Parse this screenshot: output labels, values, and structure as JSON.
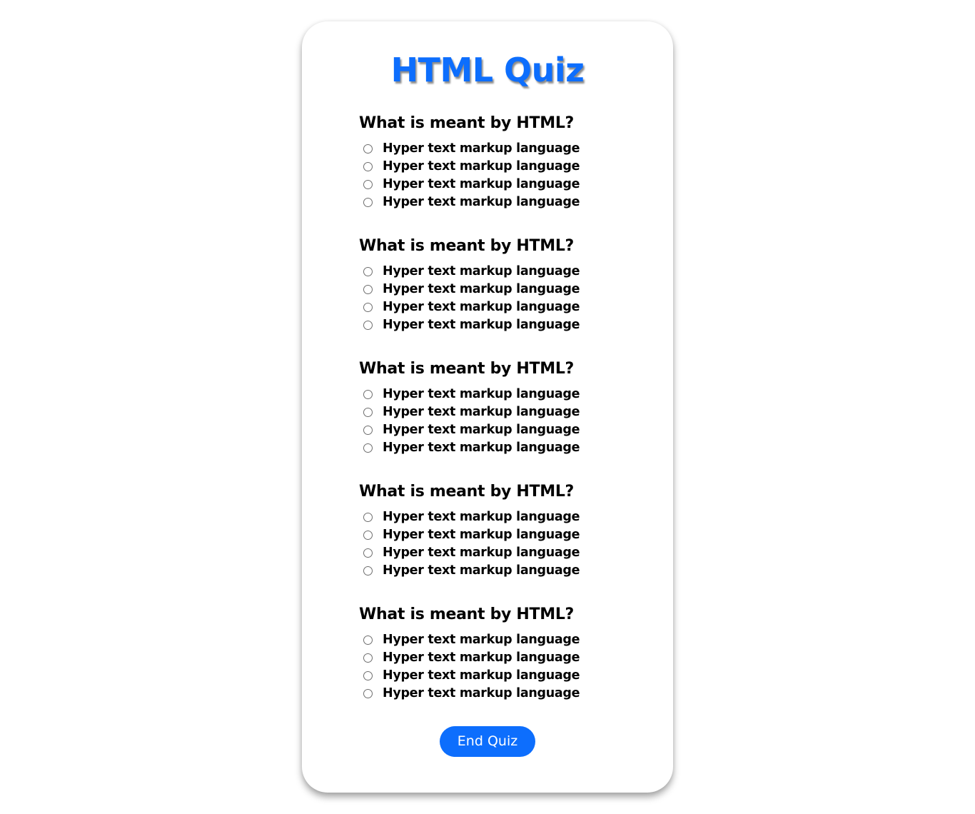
{
  "title": "HTML Quiz",
  "accent_color": "#0d6efd",
  "questions": [
    {
      "text": "What is meant by HTML?",
      "options": [
        "Hyper text markup language",
        "Hyper text markup language",
        "Hyper text markup language",
        "Hyper text markup language"
      ]
    },
    {
      "text": "What is meant by HTML?",
      "options": [
        "Hyper text markup language",
        "Hyper text markup language",
        "Hyper text markup language",
        "Hyper text markup language"
      ]
    },
    {
      "text": "What is meant by HTML?",
      "options": [
        "Hyper text markup language",
        "Hyper text markup language",
        "Hyper text markup language",
        "Hyper text markup language"
      ]
    },
    {
      "text": "What is meant by HTML?",
      "options": [
        "Hyper text markup language",
        "Hyper text markup language",
        "Hyper text markup language",
        "Hyper text markup language"
      ]
    },
    {
      "text": "What is meant by HTML?",
      "options": [
        "Hyper text markup language",
        "Hyper text markup language",
        "Hyper text markup language",
        "Hyper text markup language"
      ]
    }
  ],
  "end_button_label": "End Quiz"
}
